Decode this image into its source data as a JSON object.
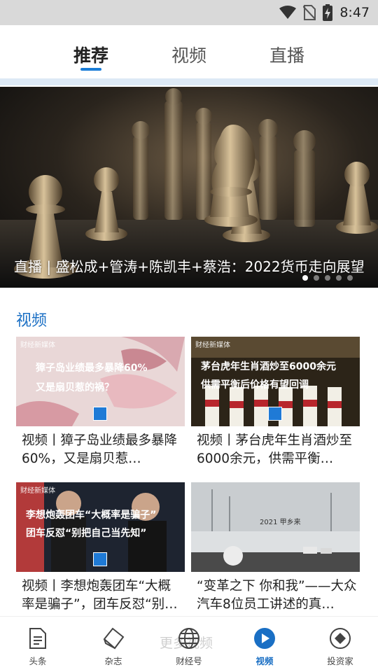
{
  "status_bar": {
    "time": "8:47"
  },
  "top_tabs": [
    {
      "label": "推荐"
    },
    {
      "label": "视频"
    },
    {
      "label": "直播"
    }
  ],
  "banner": {
    "caption": "直播 | 盛松成+管涛+陈凯丰+蔡浩：2022货币走向展望",
    "page_count": 5,
    "active_page": 1
  },
  "section": {
    "title": "视频"
  },
  "cards": [
    {
      "title": "视频丨獐子岛业绩最多暴降60%，又是扇贝惹…",
      "thumb_line1": "獐子岛业绩最多暴降60%",
      "thumb_line2": "又是扇贝惹的祸？",
      "brand": "财经新媒体"
    },
    {
      "title": "视频丨茅台虎年生肖酒炒至6000余元，供需平衡…",
      "thumb_line1": "茅台虎年生肖酒炒至6000余元",
      "thumb_line2": "供需平衡后价格有望回调",
      "brand": "财经新媒体"
    },
    {
      "title": "视频丨李想炮轰团车“大概率是骗子”，团车反怼“别…",
      "thumb_line1": "李想炮轰团车“大概率是骗子”",
      "thumb_line2": "团车反怼“别把自己当先知”",
      "brand": "财经新媒体"
    },
    {
      "title": "“变革之下 你和我”——大众汽车8位员工讲述的真…",
      "thumb_line1": "2021 甲乡来",
      "thumb_line2": "",
      "brand": ""
    }
  ],
  "bottom_ghost_text": "更多视频",
  "bottom_nav": [
    {
      "label": "头条",
      "icon": "document-icon"
    },
    {
      "label": "杂志",
      "icon": "magazine-icon"
    },
    {
      "label": "财经号",
      "icon": "globe-icon"
    },
    {
      "label": "视频",
      "icon": "play-icon",
      "active": true
    },
    {
      "label": "投资家",
      "icon": "diamond-target-icon"
    }
  ],
  "colors": {
    "accent": "#1a6fc4",
    "status_bar_bg": "#d9d9d9",
    "tab_underline": "#1a7dd7"
  }
}
